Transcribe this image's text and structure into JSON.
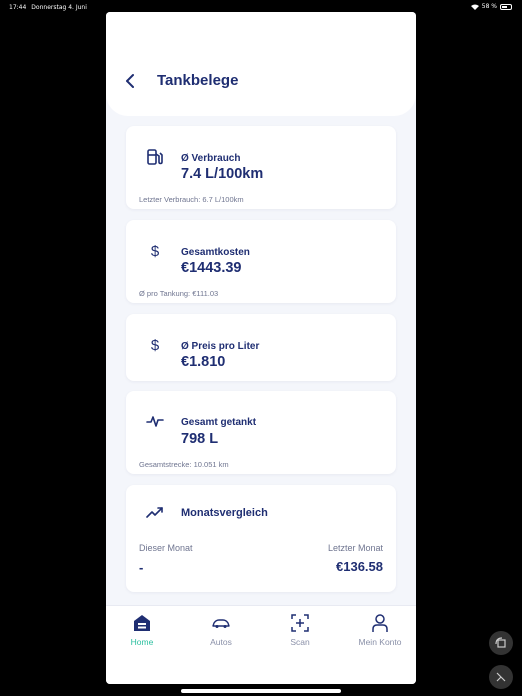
{
  "status_bar": {
    "time": "17:44",
    "date": "Donnerstag 4. Juni",
    "battery": "58 %"
  },
  "header": {
    "title": "Tankbelege",
    "back_icon": "chevron-left-icon"
  },
  "cards": {
    "consumption": {
      "icon": "fuel-pump-icon",
      "label": "Ø Verbrauch",
      "value": "7.4 L/100km",
      "sub": "Letzter Verbrauch: 6.7 L/100km"
    },
    "total_cost": {
      "icon": "dollar-icon",
      "label": "Gesamtkosten",
      "value": "€1443.39",
      "sub": "Ø pro Tankung: €111.03"
    },
    "price_per_liter": {
      "icon": "dollar-icon",
      "label": "Ø Preis pro Liter",
      "value": "€1.810"
    },
    "total_fueled": {
      "icon": "activity-icon",
      "label": "Gesamt getankt",
      "value": "798 L",
      "sub": "Gesamtstrecke: 10.051 km"
    },
    "monthly_comparison": {
      "icon": "trending-up-icon",
      "label": "Monatsvergleich",
      "this_month_label": "Dieser Monat",
      "this_month_value": "-",
      "last_month_label": "Letzter Monat",
      "last_month_value": "€136.58"
    }
  },
  "tabbar": {
    "home": "Home",
    "autos": "Autos",
    "scan": "Scan",
    "account": "Mein Konto",
    "active": "home"
  },
  "colors": {
    "primary": "#1f2e72",
    "accent": "#2bbf9f",
    "background": "#f4f6fb"
  }
}
